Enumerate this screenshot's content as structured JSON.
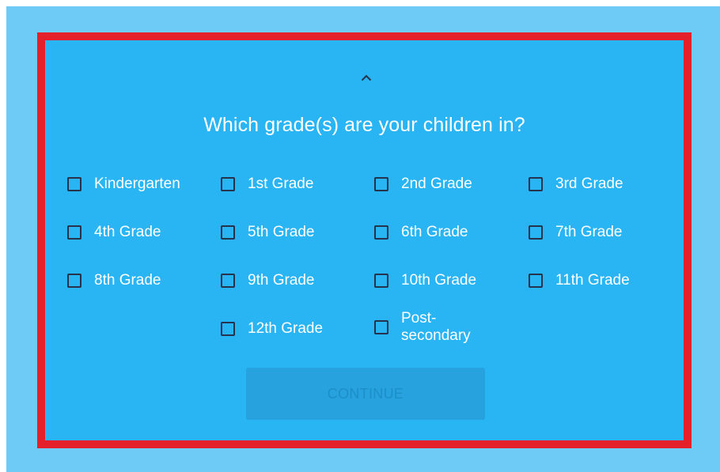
{
  "survey": {
    "collapse_icon": "chevron-up-icon",
    "question": "Which grade(s) are your children in?",
    "options": [
      {
        "label": "Kindergarten",
        "checked": false
      },
      {
        "label": "1st Grade",
        "checked": false
      },
      {
        "label": "2nd Grade",
        "checked": false
      },
      {
        "label": "3rd Grade",
        "checked": false
      },
      {
        "label": "4th Grade",
        "checked": false
      },
      {
        "label": "5th Grade",
        "checked": false
      },
      {
        "label": "6th Grade",
        "checked": false
      },
      {
        "label": "7th Grade",
        "checked": false
      },
      {
        "label": "8th Grade",
        "checked": false
      },
      {
        "label": "9th Grade",
        "checked": false
      },
      {
        "label": "10th Grade",
        "checked": false
      },
      {
        "label": "11th Grade",
        "checked": false
      },
      {
        "label": "12th Grade",
        "checked": false
      },
      {
        "label": "Post-secondary",
        "checked": false
      }
    ],
    "continue_label": "CONTINUE",
    "continue_enabled": false
  },
  "colors": {
    "page_background": "#6ecbf5",
    "panel_background": "#29b4f4",
    "highlight_border": "#e4202a",
    "checkbox_border": "#26334a",
    "button_background": "#27a2de",
    "button_text": "#1b8fc8"
  }
}
